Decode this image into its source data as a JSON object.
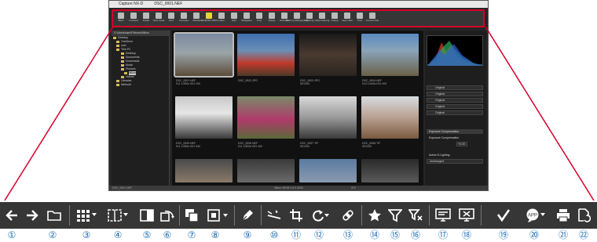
{
  "window": {
    "app_name": "Capture NX-D",
    "file_name": "DSC_0001.NEF"
  },
  "mini_toolbar": {
    "labels": [
      "Back",
      "Forward",
      "Folder",
      "View mode",
      "Grid",
      "Compare",
      "Rotate",
      "NEF/RAW+JPEG",
      "Label",
      "Edit",
      "Straighten",
      "Crop",
      "Rotate",
      "Retouch",
      "Filter by Rating/Label",
      "Filtering",
      "Clear Filtering",
      "Output",
      "Open with",
      "Print",
      "Convert File"
    ]
  },
  "left_panel": {
    "path": "C:\\Users\\user\\Pictures\\Nikon",
    "tree": [
      "Desktop",
      "OneDrive",
      "user",
      "This PC",
      "Desktop",
      "Documents",
      "Downloads",
      "Music",
      "Pictures",
      "Nikon",
      "Videos",
      "Libraries",
      "Network"
    ]
  },
  "thumbnails": [
    {
      "name": "DSC_0001.NEF",
      "info": "f/11 1/250s ISO 200"
    },
    {
      "name": "DSC_0002.JPG",
      "info": ""
    },
    {
      "name": "DSC_0003.JPG",
      "info": "ISO400"
    },
    {
      "name": "DSC_0004.NEF",
      "info": "f/10 1/400s ISO 400"
    },
    {
      "name": "DSC_0005.NEF",
      "info": "f/11 1/250s ISO 400"
    },
    {
      "name": "DSC_0006.NEF",
      "info": "f/11 1/500s ISO 400"
    },
    {
      "name": "DSC_0007.TIF",
      "info": "ISO400"
    },
    {
      "name": "DSC_0008.TIF",
      "info": "ISO400"
    }
  ],
  "right_panel": {
    "edit_rows": [
      "Original",
      "Original",
      "Original",
      "Original",
      "Original"
    ],
    "exposure_title": "Exposure Compensation",
    "exposure_label": "Exposure Compensation",
    "exposure_value": "+0.00",
    "active_d_label": "Active D-Lighting",
    "active_d_value": "Unchanged"
  },
  "status": {
    "left": "DSC_0001.NEF",
    "middle": "Nikon sRGB 4.0.0.3000",
    "zoom": "370"
  },
  "big_toolbar": {
    "numbers": [
      "①",
      "②",
      "③",
      "④",
      "⑤",
      "⑥",
      "⑦",
      "⑧",
      "⑨",
      "⑩",
      "⑪",
      "⑫",
      "⑬",
      "⑭",
      "⑮",
      "⑯",
      "⑰",
      "⑱",
      "⑲",
      "⑳",
      "㉑",
      "㉒"
    ]
  },
  "colors": {
    "toolbar_bg": "#363636",
    "highlight": "#d8002a",
    "number_blue": "#1d6fb8"
  }
}
